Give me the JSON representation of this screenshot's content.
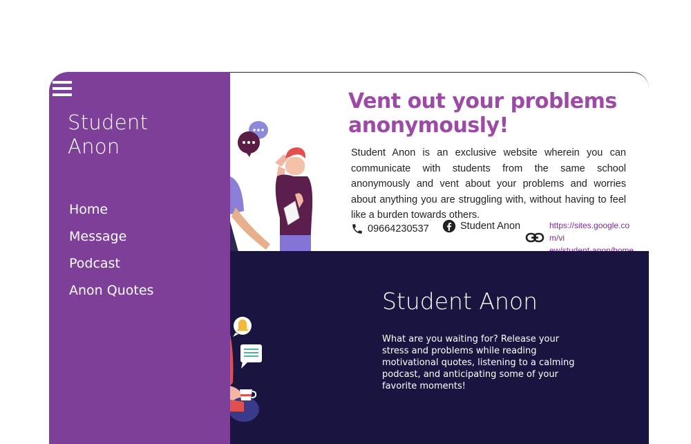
{
  "sidebar": {
    "brand_line1": "Student",
    "brand_line2": "Anon",
    "menu_icon": "hamburger-menu-icon",
    "items": [
      {
        "label": "Home"
      },
      {
        "label": "Message"
      },
      {
        "label": "Podcast"
      },
      {
        "label": "Anon Quotes"
      }
    ]
  },
  "banner": {
    "headline_line1": "Vent out your problems",
    "headline_line2": "anonymously!",
    "description": "Student Anon is an exclusive website wherein you can communicate with students from the same school anonymously and vent about your problems and worries about anything you are struggling with, without having to feel like a burden towards others.",
    "phone": "09664230537",
    "facebook": "Student Anon",
    "link_line1": "https://sites.google.com/vi",
    "link_line2": "ew/student-anon/home"
  },
  "dark_section": {
    "title": "Student Anon",
    "description": "What are you waiting for? Release your stress and problems while reading motivational quotes, listening to a calming podcast, and anticipating some of your favorite moments!"
  },
  "colors": {
    "sidebar": "#7e3f98",
    "headline": "#9c4aa6",
    "dark_bg": "#1a1540",
    "link": "#7a2a9a"
  }
}
